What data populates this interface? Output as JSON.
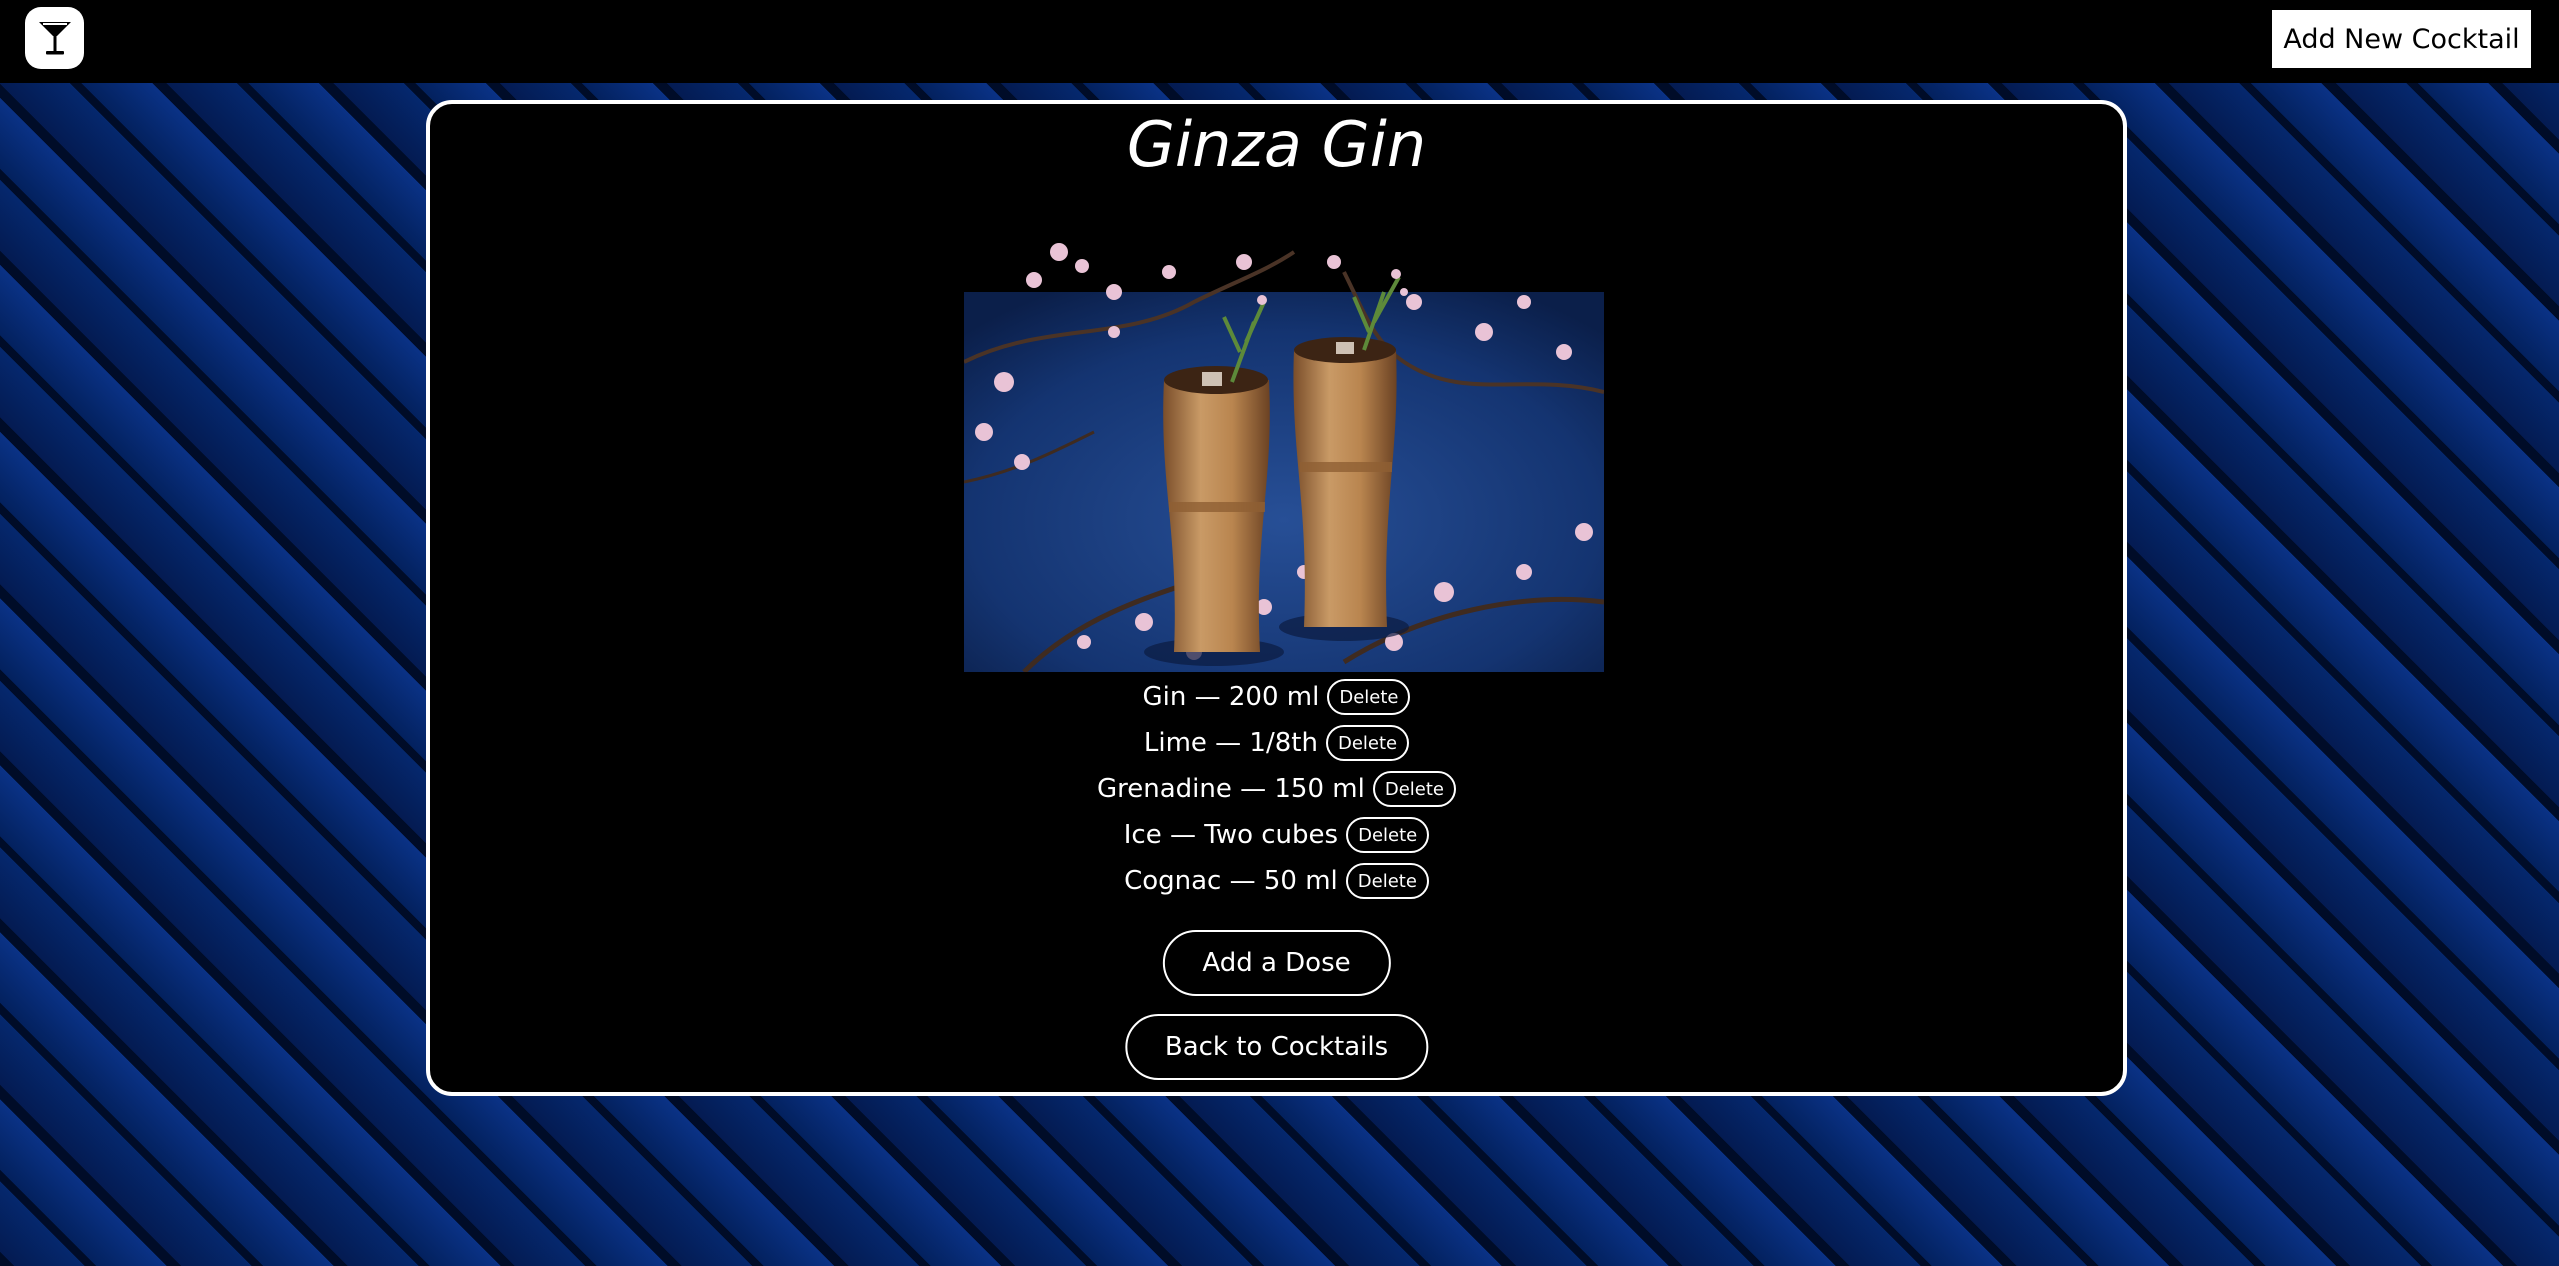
{
  "navbar": {
    "logo_icon": "cocktail-glass-icon",
    "add_cocktail_label": "Add New Cocktail"
  },
  "cocktail": {
    "name": "Ginza Gin",
    "photo_description_icon": "cocktail-photo",
    "doses": [
      {
        "text": "Gin — 200 ml",
        "delete_label": "Delete"
      },
      {
        "text": "Lime — 1/8th",
        "delete_label": "Delete"
      },
      {
        "text": "Grenadine — 150 ml",
        "delete_label": "Delete"
      },
      {
        "text": "Ice — Two cubes",
        "delete_label": "Delete"
      },
      {
        "text": "Cognac — 50 ml",
        "delete_label": "Delete"
      }
    ],
    "add_dose_label": "Add a Dose",
    "back_label": "Back to Cocktails"
  },
  "colors": {
    "background_dark": "#000c28",
    "background_blue": "#0a3286",
    "card": "#000000",
    "text": "#ffffff"
  }
}
